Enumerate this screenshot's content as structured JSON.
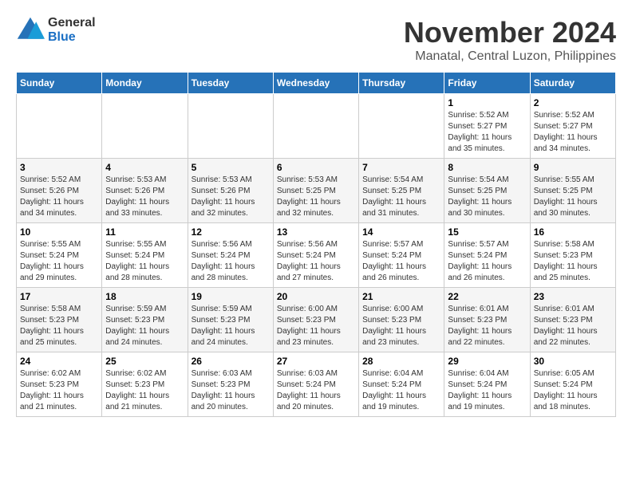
{
  "header": {
    "logo_general": "General",
    "logo_blue": "Blue",
    "month": "November 2024",
    "location": "Manatal, Central Luzon, Philippines"
  },
  "weekdays": [
    "Sunday",
    "Monday",
    "Tuesday",
    "Wednesday",
    "Thursday",
    "Friday",
    "Saturday"
  ],
  "weeks": [
    [
      {
        "day": "",
        "info": ""
      },
      {
        "day": "",
        "info": ""
      },
      {
        "day": "",
        "info": ""
      },
      {
        "day": "",
        "info": ""
      },
      {
        "day": "",
        "info": ""
      },
      {
        "day": "1",
        "info": "Sunrise: 5:52 AM\nSunset: 5:27 PM\nDaylight: 11 hours\nand 35 minutes."
      },
      {
        "day": "2",
        "info": "Sunrise: 5:52 AM\nSunset: 5:27 PM\nDaylight: 11 hours\nand 34 minutes."
      }
    ],
    [
      {
        "day": "3",
        "info": "Sunrise: 5:52 AM\nSunset: 5:26 PM\nDaylight: 11 hours\nand 34 minutes."
      },
      {
        "day": "4",
        "info": "Sunrise: 5:53 AM\nSunset: 5:26 PM\nDaylight: 11 hours\nand 33 minutes."
      },
      {
        "day": "5",
        "info": "Sunrise: 5:53 AM\nSunset: 5:26 PM\nDaylight: 11 hours\nand 32 minutes."
      },
      {
        "day": "6",
        "info": "Sunrise: 5:53 AM\nSunset: 5:25 PM\nDaylight: 11 hours\nand 32 minutes."
      },
      {
        "day": "7",
        "info": "Sunrise: 5:54 AM\nSunset: 5:25 PM\nDaylight: 11 hours\nand 31 minutes."
      },
      {
        "day": "8",
        "info": "Sunrise: 5:54 AM\nSunset: 5:25 PM\nDaylight: 11 hours\nand 30 minutes."
      },
      {
        "day": "9",
        "info": "Sunrise: 5:55 AM\nSunset: 5:25 PM\nDaylight: 11 hours\nand 30 minutes."
      }
    ],
    [
      {
        "day": "10",
        "info": "Sunrise: 5:55 AM\nSunset: 5:24 PM\nDaylight: 11 hours\nand 29 minutes."
      },
      {
        "day": "11",
        "info": "Sunrise: 5:55 AM\nSunset: 5:24 PM\nDaylight: 11 hours\nand 28 minutes."
      },
      {
        "day": "12",
        "info": "Sunrise: 5:56 AM\nSunset: 5:24 PM\nDaylight: 11 hours\nand 28 minutes."
      },
      {
        "day": "13",
        "info": "Sunrise: 5:56 AM\nSunset: 5:24 PM\nDaylight: 11 hours\nand 27 minutes."
      },
      {
        "day": "14",
        "info": "Sunrise: 5:57 AM\nSunset: 5:24 PM\nDaylight: 11 hours\nand 26 minutes."
      },
      {
        "day": "15",
        "info": "Sunrise: 5:57 AM\nSunset: 5:24 PM\nDaylight: 11 hours\nand 26 minutes."
      },
      {
        "day": "16",
        "info": "Sunrise: 5:58 AM\nSunset: 5:23 PM\nDaylight: 11 hours\nand 25 minutes."
      }
    ],
    [
      {
        "day": "17",
        "info": "Sunrise: 5:58 AM\nSunset: 5:23 PM\nDaylight: 11 hours\nand 25 minutes."
      },
      {
        "day": "18",
        "info": "Sunrise: 5:59 AM\nSunset: 5:23 PM\nDaylight: 11 hours\nand 24 minutes."
      },
      {
        "day": "19",
        "info": "Sunrise: 5:59 AM\nSunset: 5:23 PM\nDaylight: 11 hours\nand 24 minutes."
      },
      {
        "day": "20",
        "info": "Sunrise: 6:00 AM\nSunset: 5:23 PM\nDaylight: 11 hours\nand 23 minutes."
      },
      {
        "day": "21",
        "info": "Sunrise: 6:00 AM\nSunset: 5:23 PM\nDaylight: 11 hours\nand 23 minutes."
      },
      {
        "day": "22",
        "info": "Sunrise: 6:01 AM\nSunset: 5:23 PM\nDaylight: 11 hours\nand 22 minutes."
      },
      {
        "day": "23",
        "info": "Sunrise: 6:01 AM\nSunset: 5:23 PM\nDaylight: 11 hours\nand 22 minutes."
      }
    ],
    [
      {
        "day": "24",
        "info": "Sunrise: 6:02 AM\nSunset: 5:23 PM\nDaylight: 11 hours\nand 21 minutes."
      },
      {
        "day": "25",
        "info": "Sunrise: 6:02 AM\nSunset: 5:23 PM\nDaylight: 11 hours\nand 21 minutes."
      },
      {
        "day": "26",
        "info": "Sunrise: 6:03 AM\nSunset: 5:23 PM\nDaylight: 11 hours\nand 20 minutes."
      },
      {
        "day": "27",
        "info": "Sunrise: 6:03 AM\nSunset: 5:24 PM\nDaylight: 11 hours\nand 20 minutes."
      },
      {
        "day": "28",
        "info": "Sunrise: 6:04 AM\nSunset: 5:24 PM\nDaylight: 11 hours\nand 19 minutes."
      },
      {
        "day": "29",
        "info": "Sunrise: 6:04 AM\nSunset: 5:24 PM\nDaylight: 11 hours\nand 19 minutes."
      },
      {
        "day": "30",
        "info": "Sunrise: 6:05 AM\nSunset: 5:24 PM\nDaylight: 11 hours\nand 18 minutes."
      }
    ]
  ]
}
